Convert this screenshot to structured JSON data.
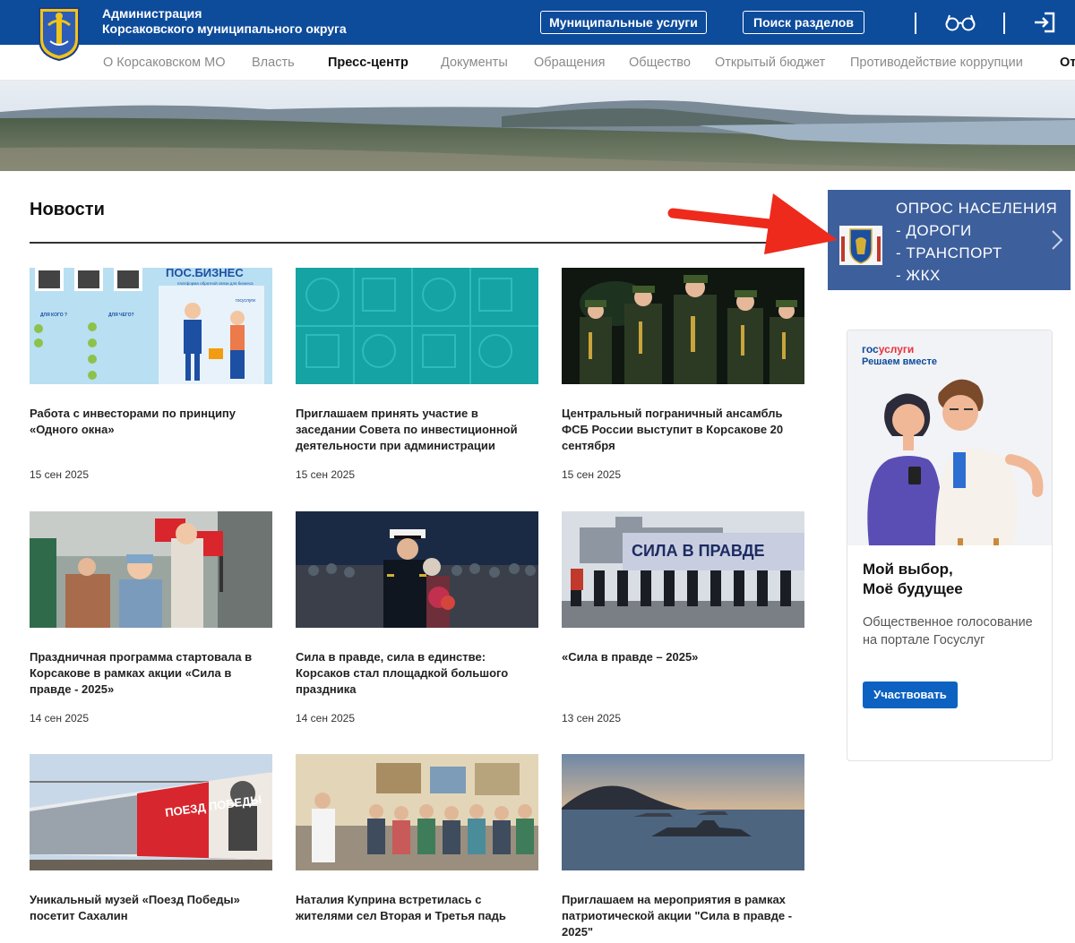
{
  "header": {
    "org_name_line1": "Администрация",
    "org_name_line2": "Корсаковского муниципального округа",
    "services_button": "Муниципальные услуги",
    "search_button": "Поиск разделов",
    "icons": [
      "crest-icon",
      "glasses-icon",
      "login-icon"
    ],
    "colors": {
      "brand": "#0d4b9b"
    }
  },
  "nav": {
    "items": [
      {
        "label": "О Корсаковском МО"
      },
      {
        "label": "Власть"
      },
      {
        "label": "Пресс-центр",
        "active": true
      },
      {
        "label": "Документы"
      },
      {
        "label": "Обращения"
      },
      {
        "label": "Общество"
      },
      {
        "label": "Открытый бюджет"
      },
      {
        "label": "Противодействие коррупции"
      },
      {
        "label": "От"
      }
    ]
  },
  "news": {
    "heading": "Новости",
    "items": [
      {
        "title": "Работа с инвесторами по принципу «Одного окна»",
        "date": "15 сен 2025",
        "image": "pos-business"
      },
      {
        "title": "Приглашаем принять участие в заседании Совета по инвестиционной деятельности при администрации Корсаковского…",
        "date": "15 сен 2025",
        "image": "teal-pattern"
      },
      {
        "title": "Центральный пограничный ансамбль ФСБ России выступит в Корсакове 20 сентября",
        "date": "15 сен 2025",
        "image": "orchestra"
      },
      {
        "title": "Праздничная программа стартовала в Корсакове в рамках акции «Сила в правде - 2025»",
        "date": "14 сен 2025",
        "image": "festival-crowd"
      },
      {
        "title": "Сила в правде, сила в единстве: Корсаков стал площадкой большого праздника",
        "date": "14 сен 2025",
        "image": "navy-officer"
      },
      {
        "title": "«Сила в правде – 2025»",
        "date": "13 сен 2025",
        "image": "ship-parade"
      },
      {
        "title": "Уникальный музей «Поезд Победы» посетит Сахалин",
        "date": "",
        "image": "victory-train"
      },
      {
        "title": "Наталия Куприна встретилась с жителями сел Вторая и Третья падь",
        "date": "",
        "image": "meeting-hall"
      },
      {
        "title": "Приглашаем на мероприятия в рамках патриотической акции \"Сила в правде - 2025\"",
        "date": "",
        "image": "warship-sunset"
      }
    ],
    "thumb_texts": {
      "pos_title": "ПОС.БИЗНЕС",
      "pos_sub": "платформа обратной связи для бизнеса",
      "pos_q1": "ДЛЯ КОГО ?",
      "pos_q2": "ДЛЯ ЧЕГО?",
      "gos": "госуслуги",
      "ship_banner": "СИЛА В ПРАВДЕ",
      "train_text": "ПОЕЗД ПОБЕДЫ"
    }
  },
  "sidebar": {
    "poll": {
      "line1": "ОПРОС НАСЕЛЕНИЯ",
      "line2": "- ДОРОГИ",
      "line3": "- ТРАНСПОРТ",
      "line4": "- ЖКХ",
      "color": "#3d5f9c"
    },
    "ad": {
      "logo_part1": "гос",
      "logo_part2": "услуги",
      "subtitle": "Решаем вместе",
      "headline_line1": "Мой выбор,",
      "headline_line2": "Моё будущее",
      "text": "Общественное голосование на портале Госуслуг",
      "button": "Участвовать",
      "button_color": "#0d62c1"
    }
  }
}
